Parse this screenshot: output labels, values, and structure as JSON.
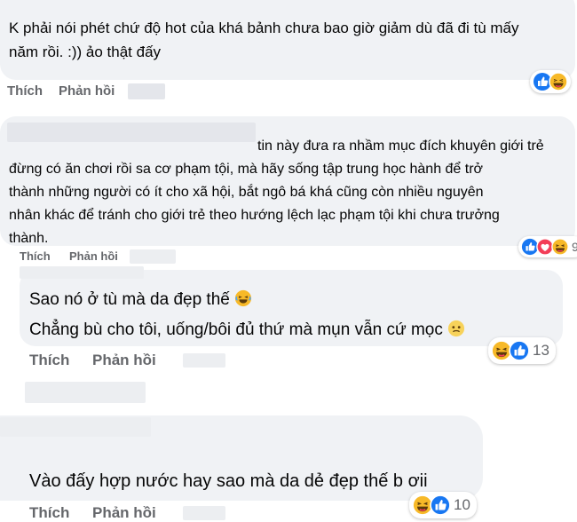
{
  "comments": [
    {
      "text_lines": [
        "K phải nói phét chứ độ hot của khá bảnh chưa bao giờ giảm dù đã đi tù mấy",
        "năm rồi. :)) ảo thật đấy"
      ],
      "actions": {
        "like": "Thích",
        "reply": "Phản hồi"
      },
      "reactions": [
        "like-icon",
        "haha-icon"
      ]
    },
    {
      "text_lines": [
        "tin này đưa ra nhầm mục đích khuyên giới trẻ",
        "đừng có ăn chơi rồi sa cơ phạm tội, mà hãy sống tập trung học hành để trở",
        "thành những người có ít cho xã hội, bắt ngô bá khá cũng còn nhiều nguyên",
        "nhân khác để tránh cho giới trẻ theo hướng lệch lạc phạm tội khi chưa trưởng",
        "thành."
      ],
      "actions": {
        "like": "Thích",
        "reply": "Phản hồi"
      },
      "reactions": [
        "like-icon",
        "love-icon",
        "haha-icon"
      ],
      "reaction_count": "9"
    },
    {
      "text_lines": [
        "Sao nó ở tù mà da đẹp thế",
        "Chẳng bù cho tôi, uống/bôi đủ thứ mà mụn vẫn cứ mọc"
      ],
      "emojis": [
        "laughing-crying-emoji",
        "worried-emoji"
      ],
      "actions": {
        "like": "Thích",
        "reply": "Phản hồi"
      },
      "reactions": [
        "haha-icon",
        "like-icon"
      ],
      "reaction_count": "13"
    },
    {
      "text_lines": [
        "Vào đấy hợp nước hay sao mà da dẻ đẹp thế b ơii"
      ],
      "actions": {
        "like": "Thích",
        "reply": "Phản hồi"
      },
      "reactions": [
        "haha-icon",
        "like-icon"
      ],
      "reaction_count": "10"
    }
  ],
  "colors": {
    "bubble": "#f0f2f5",
    "action_text": "#65676b",
    "like_blue": "#1877f2",
    "love_red": "#f33e58",
    "haha_yellow": "#f7b928"
  }
}
